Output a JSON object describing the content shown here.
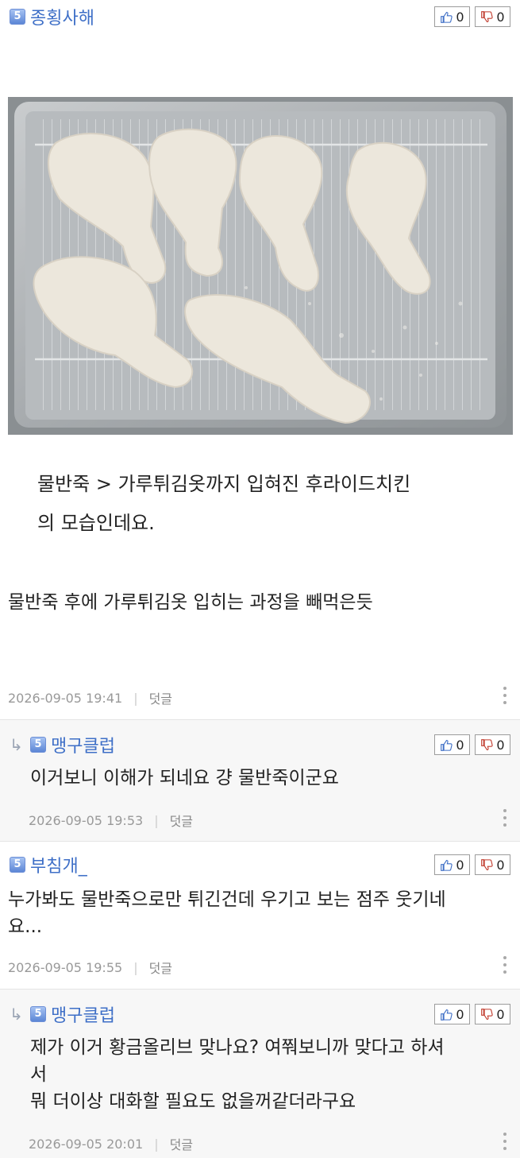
{
  "comments": [
    {
      "level": "5",
      "nick": "종횡사해",
      "likes": "0",
      "dislikes": "0",
      "quote_line1": "물반죽 > 가루튀김옷까지 입혀진 후라이드치킨",
      "quote_line2": "의 모습인데요.",
      "text": "물반죽 후에 가루튀김옷 입히는 과정을 빼먹은듯",
      "date": "2026-09-05 19:41",
      "reply_label": "덧글"
    },
    {
      "level": "5",
      "nick": "맹구클럽",
      "likes": "0",
      "dislikes": "0",
      "text": "이거보니 이해가 되네요 걍 물반죽이군요",
      "date": "2026-09-05 19:53",
      "reply_label": "덧글"
    },
    {
      "level": "5",
      "nick": "부침개_",
      "likes": "0",
      "dislikes": "0",
      "text_line1": "누가봐도 물반죽으로만 튀긴건데 우기고 보는 점주 웃기네",
      "text_line2": "요...",
      "date": "2026-09-05 19:55",
      "reply_label": "덧글"
    },
    {
      "level": "5",
      "nick": "맹구클럽",
      "likes": "0",
      "dislikes": "0",
      "text_line1": "제가 이거 황금올리브 맞나요? 여쭤보니까 맞다고 하셔",
      "text_line2": "서",
      "text_line3": "뭐 더이상 대화할 필요도 없을꺼같더라구요",
      "date": "2026-09-05 20:01",
      "reply_label": "덧글"
    }
  ],
  "icons": {
    "like": "thumbs-up-icon",
    "dislike": "thumbs-down-icon",
    "reply_arrow": "reply-arrow-icon",
    "more": "more-vertical-icon"
  },
  "colors": {
    "nick": "#3e6fc7",
    "meta": "#999999",
    "reply_bg": "#f7f7f7"
  }
}
